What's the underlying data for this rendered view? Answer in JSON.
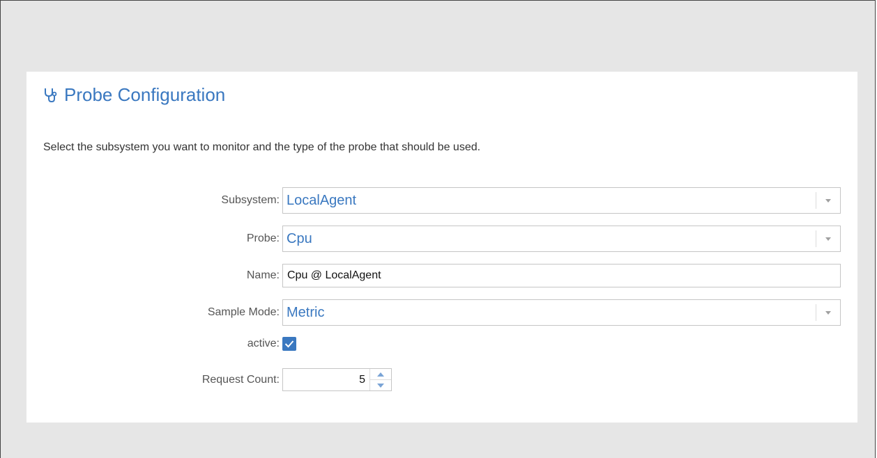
{
  "panel": {
    "title": "Probe Configuration",
    "title_icon": "stethoscope-icon",
    "description": "Select the subsystem you want to monitor and the type of the probe that should be used."
  },
  "form": {
    "subsystem": {
      "label": "Subsystem:",
      "value": "LocalAgent"
    },
    "probe": {
      "label": "Probe:",
      "value": "Cpu"
    },
    "name": {
      "label": "Name:",
      "value": "Cpu @ LocalAgent"
    },
    "sample_mode": {
      "label": "Sample Mode:",
      "value": "Metric"
    },
    "active": {
      "label": "active:",
      "checked": true
    },
    "request_count": {
      "label": "Request Count:",
      "value": "5"
    }
  },
  "colors": {
    "accent": "#3a78c0",
    "background": "#e6e6e6"
  }
}
